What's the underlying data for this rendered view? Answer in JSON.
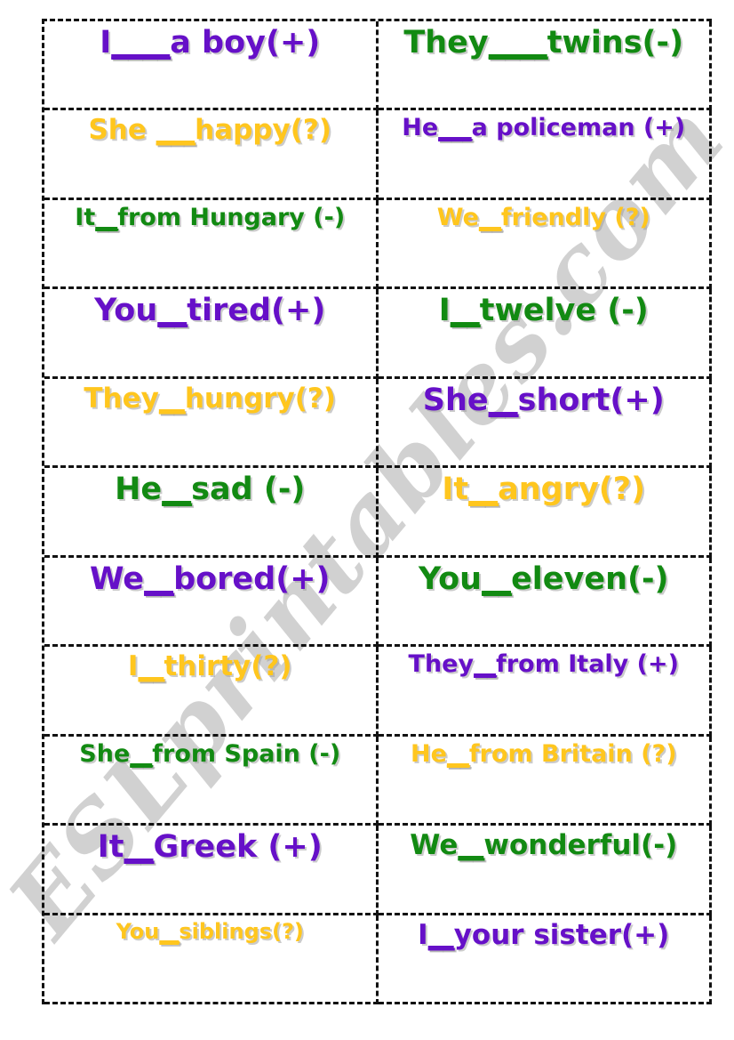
{
  "worksheet": {
    "watermark": "ESLprintables.com",
    "columns": 2,
    "rows": 11,
    "total_cards": 22,
    "palette": {
      "purple": "#6610c8",
      "green": "#128a12",
      "gold": "#ffc61e",
      "border": "#111111",
      "watermark": "#c9c9c9",
      "background": "#ffffff"
    }
  },
  "cards": [
    {
      "subject": "I",
      "blank": "____",
      "predicate": "a boy(+)",
      "full_text": "I____a boy(+)",
      "color": "purple",
      "size": "xl"
    },
    {
      "subject": "They",
      "blank": "____",
      "predicate": "twins(-)",
      "full_text": "They____twins(-)",
      "color": "green",
      "size": "xl"
    },
    {
      "subject": "She ",
      "blank": "___",
      "predicate": "happy(?)",
      "full_text": "She ___happy(?)",
      "color": "gold",
      "size": "lg"
    },
    {
      "subject": "He",
      "blank": "___",
      "predicate": "a policeman (+)",
      "full_text": "He___a policeman (+)",
      "color": "purple",
      "size": "md"
    },
    {
      "subject": "It",
      "blank": "__",
      "predicate": "from Hungary (-)",
      "full_text": "It__from Hungary (-)",
      "color": "green",
      "size": "md"
    },
    {
      "subject": "We",
      "blank": "__",
      "predicate": "friendly (?)",
      "full_text": "We__friendly (?)",
      "color": "gold",
      "size": "md"
    },
    {
      "subject": "You",
      "blank": "__",
      "predicate": "tired(+)",
      "full_text": "You__tired(+)",
      "color": "purple",
      "size": "xl"
    },
    {
      "subject": "I",
      "blank": "__",
      "predicate": "twelve (-)",
      "full_text": "I__twelve (-)",
      "color": "green",
      "size": "xl"
    },
    {
      "subject": "They",
      "blank": "__",
      "predicate": "hungry(?)",
      "full_text": "They__hungry(?)",
      "color": "gold",
      "size": "lg"
    },
    {
      "subject": "She",
      "blank": "__",
      "predicate": "short(+)",
      "full_text": "She__short(+)",
      "color": "purple",
      "size": "xl"
    },
    {
      "subject": "He",
      "blank": "__",
      "predicate": "sad (-)",
      "full_text": "He__sad (-)",
      "color": "green",
      "size": "xl"
    },
    {
      "subject": "It",
      "blank": "__",
      "predicate": "angry(?)",
      "full_text": "It__angry(?)",
      "color": "gold",
      "size": "xl"
    },
    {
      "subject": "We",
      "blank": "__",
      "predicate": "bored(+)",
      "full_text": "We__bored(+)",
      "color": "purple",
      "size": "xl"
    },
    {
      "subject": "You",
      "blank": "__",
      "predicate": "eleven(-)",
      "full_text": "You__eleven(-)",
      "color": "green",
      "size": "xl"
    },
    {
      "subject": "I",
      "blank": "__",
      "predicate": "thirty(?)",
      "full_text": "I__thirty(?)",
      "color": "gold",
      "size": "lg"
    },
    {
      "subject": "They",
      "blank": "__",
      "predicate": "from Italy (+)",
      "full_text": "They__from Italy (+)",
      "color": "purple",
      "size": "md"
    },
    {
      "subject": "She",
      "blank": "__",
      "predicate": "from Spain (-)",
      "full_text": "She__from Spain (-)",
      "color": "green",
      "size": "md"
    },
    {
      "subject": "He",
      "blank": "__",
      "predicate": "from Britain (?)",
      "full_text": "He__from Britain (?)",
      "color": "gold",
      "size": "md"
    },
    {
      "subject": "It",
      "blank": "__",
      "predicate": "Greek (+)",
      "full_text": "It__Greek (+)",
      "color": "purple",
      "size": "xl"
    },
    {
      "subject": "We",
      "blank": "__",
      "predicate": "wonderful(-)",
      "full_text": "We__wonderful(-)",
      "color": "green",
      "size": "lg"
    },
    {
      "subject": "You",
      "blank": "__",
      "predicate": "siblings(?)",
      "full_text": "You__siblings(?)",
      "color": "gold",
      "size": "sm"
    },
    {
      "subject": "I",
      "blank": "__",
      "predicate": "your sister(+)",
      "full_text": "I__your sister(+)",
      "color": "purple",
      "size": "lg"
    }
  ]
}
